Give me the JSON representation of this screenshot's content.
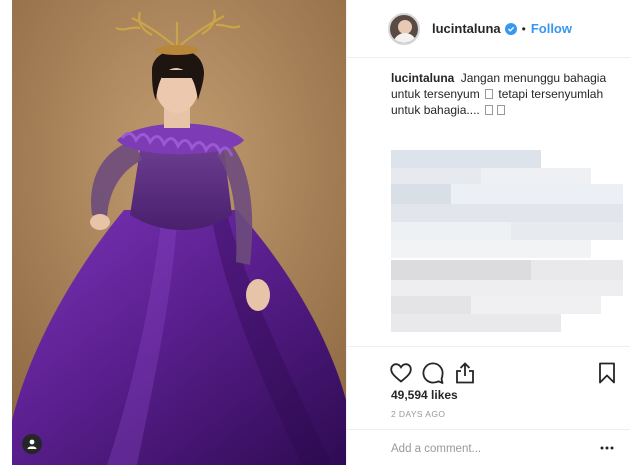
{
  "post": {
    "author": {
      "username": "lucintaluna",
      "verified": true,
      "follow_label": "Follow",
      "separator": "•"
    },
    "caption": {
      "username": "lucintaluna",
      "text_1": "Jangan menunggu bahagia untuk tersenyum",
      "text_2": "tetapi tersenyumlah untuk bahagia....",
      "emoji_glyph": "□"
    },
    "likes": "49,594 likes",
    "time": "2 DAYS AGO",
    "comment": {
      "placeholder": "Add a comment..."
    },
    "icons": {
      "like": "heart-icon",
      "comment": "comment-icon",
      "share": "share-icon",
      "save": "bookmark-icon",
      "more": "more-options-icon",
      "user_tag": "user-tag-icon",
      "verified": "verified-badge-icon"
    },
    "colors": {
      "link": "#3897f0",
      "text": "#262626",
      "muted": "#999999",
      "border": "#efefef",
      "photo_background": "#a47e55",
      "dress": "#5b1f8f"
    }
  }
}
